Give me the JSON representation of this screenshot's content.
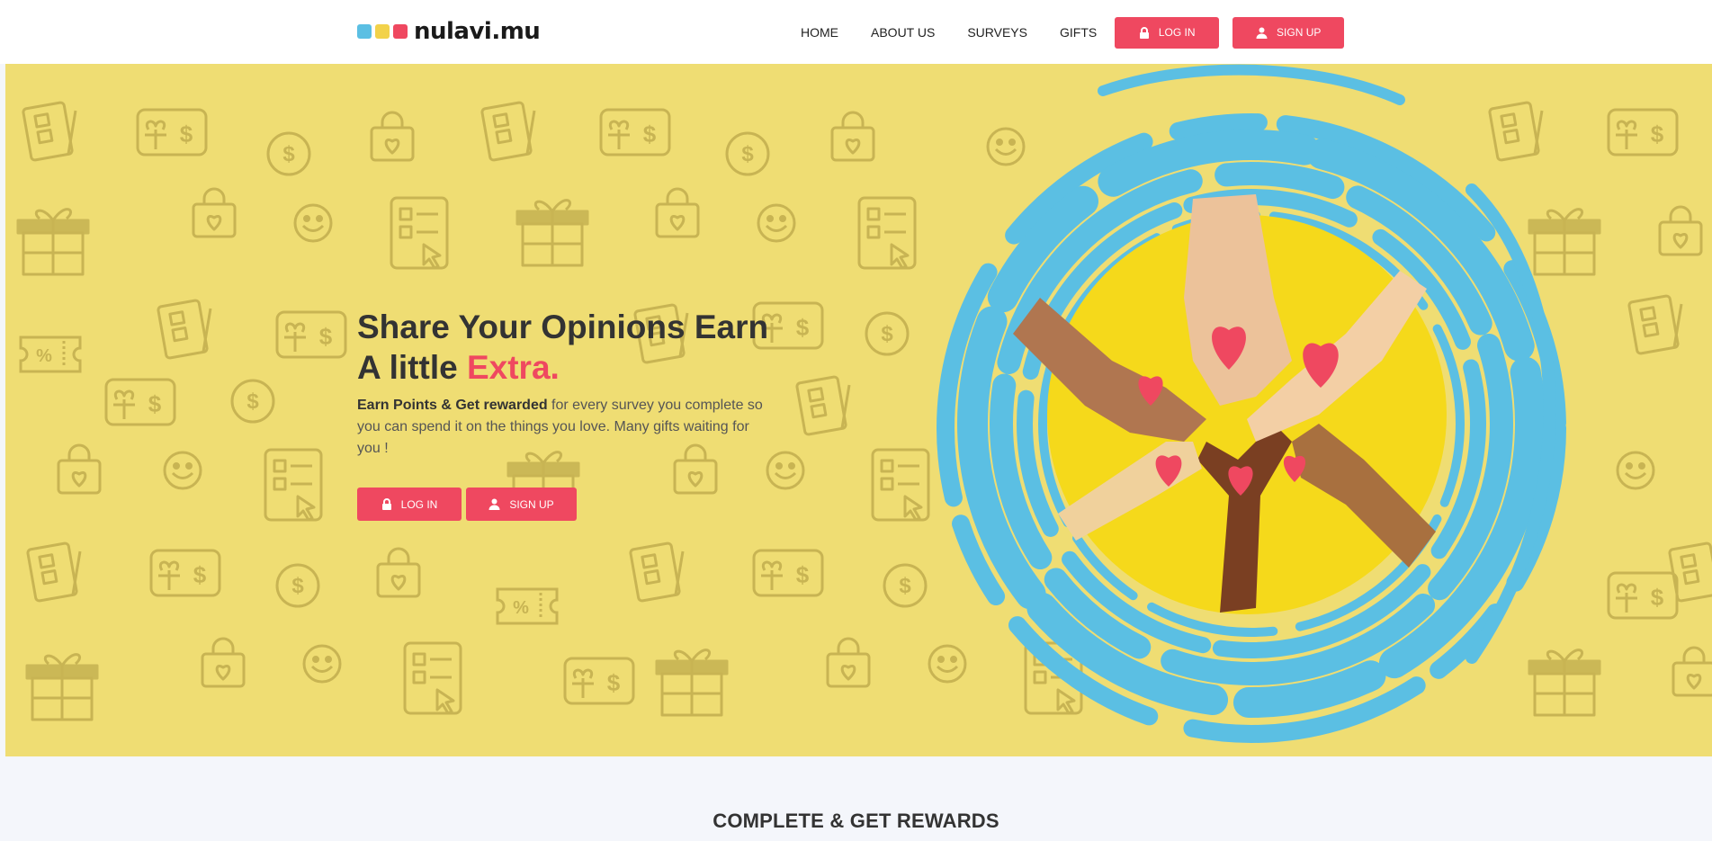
{
  "brand": {
    "name": "nulavi.mu",
    "colors": [
      "#5bbfe3",
      "#f2d24a",
      "#ef4860"
    ]
  },
  "nav": {
    "items": [
      "HOME",
      "ABOUT US",
      "SURVEYS",
      "GIFTS"
    ],
    "login_label": "LOG IN",
    "signup_label": "SIGN UP"
  },
  "hero": {
    "title_line1": "Share Your Opinions Earn",
    "title_line2_prefix": "A little ",
    "title_line2_accent": "Extra.",
    "desc_bold": "Earn Points & Get rewarded",
    "desc_rest": " for every survey you complete so you can spend it on the things you love. Many gifts waiting for you !",
    "login_label": "LOG IN",
    "signup_label": "SIGN UP"
  },
  "section": {
    "title": "COMPLETE & GET REWARDS"
  },
  "theme": {
    "accent": "#ef4860",
    "hero_bg": "#efdd73",
    "swirl": "#5bbfe3"
  },
  "icons": [
    "lock-icon",
    "user-icon",
    "gift-icon",
    "dollar-coin-icon",
    "smiley-icon",
    "shopping-bag-icon",
    "checklist-icon",
    "voucher-icon",
    "coupon-icon"
  ]
}
